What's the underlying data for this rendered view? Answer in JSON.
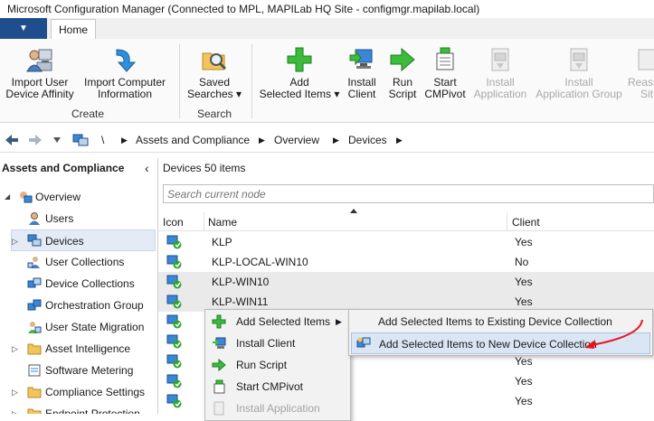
{
  "window": {
    "title": "Microsoft Configuration Manager (Connected to MPL, MAPILab HQ Site - configmgr.mapilab.local)"
  },
  "ribbon": {
    "file_tab": "▼",
    "home_tab": "Home",
    "groups": {
      "create": "Create",
      "search": "Search"
    },
    "buttons": {
      "import_user_affinity": {
        "line1": "Import User",
        "line2": "Device Affinity"
      },
      "import_computer_info": {
        "line1": "Import Computer",
        "line2": "Information"
      },
      "saved_searches": {
        "line1": "Saved",
        "line2": "Searches"
      },
      "add_selected_items": {
        "line1": "Add",
        "line2": "Selected Items"
      },
      "install_client": {
        "line1": "Install",
        "line2": "Client"
      },
      "run_script": {
        "line1": "Run",
        "line2": "Script"
      },
      "start_cmpivot": {
        "line1": "Start",
        "line2": "CMPivot"
      },
      "install_application": {
        "line1": "Install",
        "line2": "Application"
      },
      "install_application_group": {
        "line1": "Install",
        "line2": "Application Group"
      },
      "reassign_site": {
        "line1": "Reass",
        "line2": "Sit"
      }
    },
    "dropdown_arrow": "▾"
  },
  "address": {
    "root": "\\",
    "crumbs": [
      "Assets and Compliance",
      "Overview",
      "Devices"
    ],
    "separator": "▶"
  },
  "nav": {
    "header": "Assets and Compliance",
    "collapse_glyph": "‹",
    "items": [
      {
        "label": "Overview",
        "level": 0,
        "expander": "◢"
      },
      {
        "label": "Users",
        "level": 1,
        "expander": ""
      },
      {
        "label": "Devices",
        "level": 1,
        "expander": "▷",
        "selected": true
      },
      {
        "label": "User Collections",
        "level": 1,
        "expander": ""
      },
      {
        "label": "Device Collections",
        "level": 1,
        "expander": ""
      },
      {
        "label": "Orchestration Group",
        "level": 1,
        "expander": ""
      },
      {
        "label": "User State Migration",
        "level": 1,
        "expander": ""
      },
      {
        "label": "Asset Intelligence",
        "level": 1,
        "expander": "▷"
      },
      {
        "label": "Software Metering",
        "level": 1,
        "expander": ""
      },
      {
        "label": "Compliance Settings",
        "level": 1,
        "expander": "▷"
      },
      {
        "label": "Endpoint Protection",
        "level": 1,
        "expander": "▷"
      }
    ]
  },
  "content": {
    "header_title": "Devices",
    "header_count": "50 items",
    "search_placeholder": "Search current node",
    "columns": {
      "icon": "Icon",
      "name": "Name",
      "client": "Client"
    },
    "rows": [
      {
        "name": "KLP",
        "client": "Yes"
      },
      {
        "name": "KLP-LOCAL-WIN10",
        "client": "No"
      },
      {
        "name": "KLP-WIN10",
        "client": "Yes",
        "highlight": true
      },
      {
        "name": "KLP-WIN11",
        "client": "Yes",
        "highlight": true
      },
      {
        "name": "",
        "client": ""
      },
      {
        "name": "",
        "client": ""
      },
      {
        "name": "",
        "client": ""
      },
      {
        "name": "",
        "client": "Yes"
      },
      {
        "name": "",
        "client": "Yes"
      },
      {
        "name": "",
        "client": "Yes"
      }
    ]
  },
  "context_menu": {
    "items": [
      {
        "label": "Add Selected Items",
        "submenu_arrow": "▶",
        "disabled": false
      },
      {
        "label": "Install Client",
        "disabled": false
      },
      {
        "label": "Run Script",
        "disabled": false
      },
      {
        "label": "Start CMPivot",
        "disabled": false
      },
      {
        "label": "Install Application",
        "disabled": true
      }
    ]
  },
  "submenu": {
    "items": [
      {
        "label": "Add Selected Items to Existing Device Collection",
        "active": false
      },
      {
        "label": "Add Selected Items to New Device Collection",
        "active": true
      }
    ]
  },
  "colors": {
    "accent_blue": "#1f4e8c",
    "menu_highlight": "#dbe6f4",
    "annotation_red": "#e8141b"
  }
}
